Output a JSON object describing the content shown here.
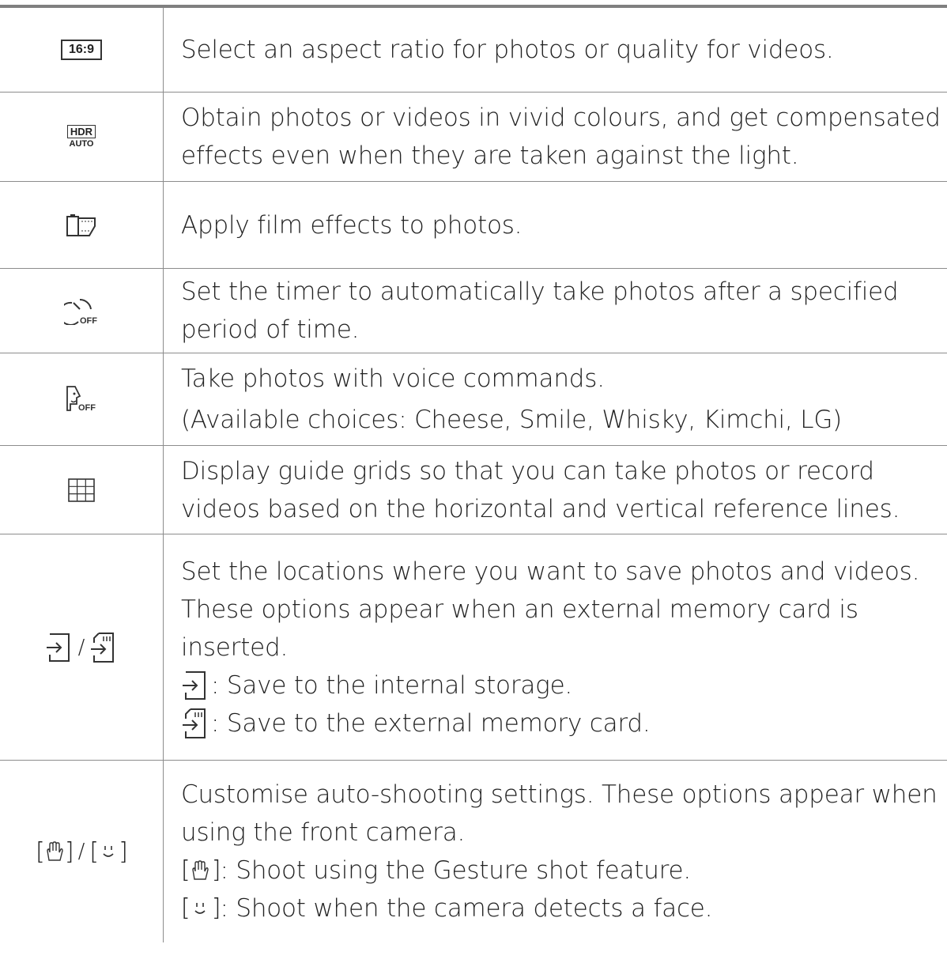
{
  "rows": [
    {
      "icon": "aspect-ratio-icon",
      "icon_text": "16:9",
      "lines": [
        "Select an aspect ratio for photos or quality for videos."
      ]
    },
    {
      "icon": "hdr-auto-icon",
      "icon_text_top": "HDR",
      "icon_text_bottom": "AUTO",
      "lines": [
        "Obtain photos or videos in vivid colours, and get compensated",
        "effects even when they are taken against the light."
      ]
    },
    {
      "icon": "film-effect-icon",
      "lines": [
        "Apply film effects to photos."
      ]
    },
    {
      "icon": "timer-off-icon",
      "icon_label": "OFF",
      "lines": [
        "Set the timer to automatically take photos after a specified",
        "period of time."
      ]
    },
    {
      "icon": "voice-shutter-off-icon",
      "icon_label": "OFF",
      "lines": [
        "Take photos with voice commands."
      ],
      "sub": "(Available choices: Cheese, Smile, Whisky, Kimchi, LG)"
    },
    {
      "icon": "grid-icon",
      "lines": [
        "Display guide grids so that you can take photos or record",
        "videos based on the horizontal and vertical reference lines."
      ]
    },
    {
      "icon": "storage-icon",
      "separator": "/",
      "lines": [
        "Set the locations where you want to save photos and videos.",
        "These options appear when an external memory card is",
        "inserted."
      ],
      "internal_text": ": Save to the internal storage.",
      "external_text": ": Save to the external memory card."
    },
    {
      "icon": "auto-shooting-icon",
      "separator": "/",
      "lines": [
        "Customise auto-shooting settings. These options appear when",
        "using the front camera."
      ],
      "gesture_text": ": Shoot using the Gesture shot feature.",
      "face_text": ": Shoot when the camera detects a face."
    }
  ]
}
